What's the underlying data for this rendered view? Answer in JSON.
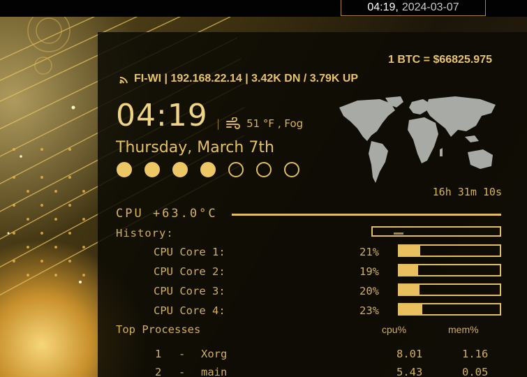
{
  "topbar": {
    "time": "04:19",
    "separator": ",",
    "date": "2024-03-07"
  },
  "conky": {
    "btc": "1 BTC = $66825.975",
    "network": {
      "icon": "wifi-icon",
      "text": "FI-WI | 192.168.22.14 | 3.42K DN / 3.79K UP"
    },
    "clock": "04:19",
    "weather": {
      "separator": "|",
      "icon": "wind-icon",
      "text": "51 °F , Fog"
    },
    "date_line": "Thursday, March  7th",
    "week_dots": {
      "filled": 4,
      "total": 7
    },
    "uptime": "16h 31m 10s",
    "cpu_title": "CPU +63.0°C",
    "history_label": "History:",
    "cores": [
      {
        "label": "CPU Core 1:",
        "pct_text": "21%",
        "value": 21
      },
      {
        "label": "CPU Core 2:",
        "pct_text": "19%",
        "value": 19
      },
      {
        "label": "CPU Core 3:",
        "pct_text": "20%",
        "value": 20
      },
      {
        "label": "CPU Core 4:",
        "pct_text": "23%",
        "value": 23
      }
    ],
    "processes": {
      "header": "Top Processes",
      "col_cpu": "cpu%",
      "col_mem": "mem%",
      "rows": [
        {
          "rank": "1",
          "dash": "-",
          "name": "Xorg",
          "cpu": "8.01",
          "mem": "1.16"
        },
        {
          "rank": "2",
          "dash": "-",
          "name": "main",
          "cpu": "5.43",
          "mem": "0.05"
        }
      ]
    }
  },
  "colors": {
    "accent": "#e2be5c",
    "panel_bg": "#0c0a04",
    "topbar_bg": "#020202"
  }
}
